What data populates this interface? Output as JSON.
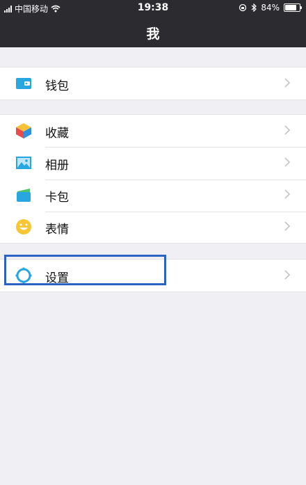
{
  "status_bar": {
    "carrier": "中国移动",
    "time": "19:38",
    "battery": "84%"
  },
  "header": {
    "title": "我"
  },
  "menu": {
    "wallet": "钱包",
    "favorites": "收藏",
    "album": "相册",
    "cards": "卡包",
    "stickers": "表情",
    "settings": "设置"
  },
  "colors": {
    "header_bg": "#2b2b30",
    "page_bg": "#efeff4",
    "highlight": "#2b63c2",
    "wallet_icon": "#27a6e0",
    "settings_icon": "#27a6e0"
  }
}
